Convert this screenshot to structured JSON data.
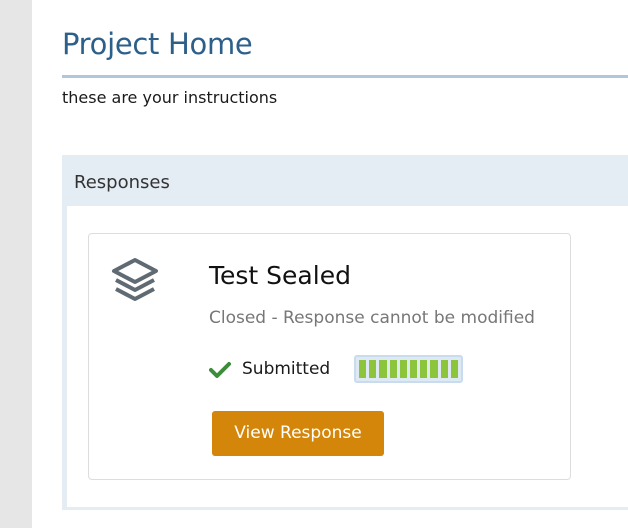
{
  "page": {
    "title": "Project Home",
    "instructions": "these are your instructions"
  },
  "responses_panel": {
    "heading": "Responses",
    "card": {
      "icon": "layers-icon",
      "title": "Test Sealed",
      "status": "Closed - Response cannot be modified",
      "submitted_icon": "check-icon",
      "submitted_label": "Submitted",
      "progress_segments": 10,
      "progress_fraction": 1.0,
      "view_button_label": "View Response"
    }
  },
  "colors": {
    "title": "#2c5f8a",
    "panel_bg": "#e4ecf4",
    "button": "#d4860b",
    "check": "#3c8c3c",
    "progress_fill": "#8cc43c"
  }
}
